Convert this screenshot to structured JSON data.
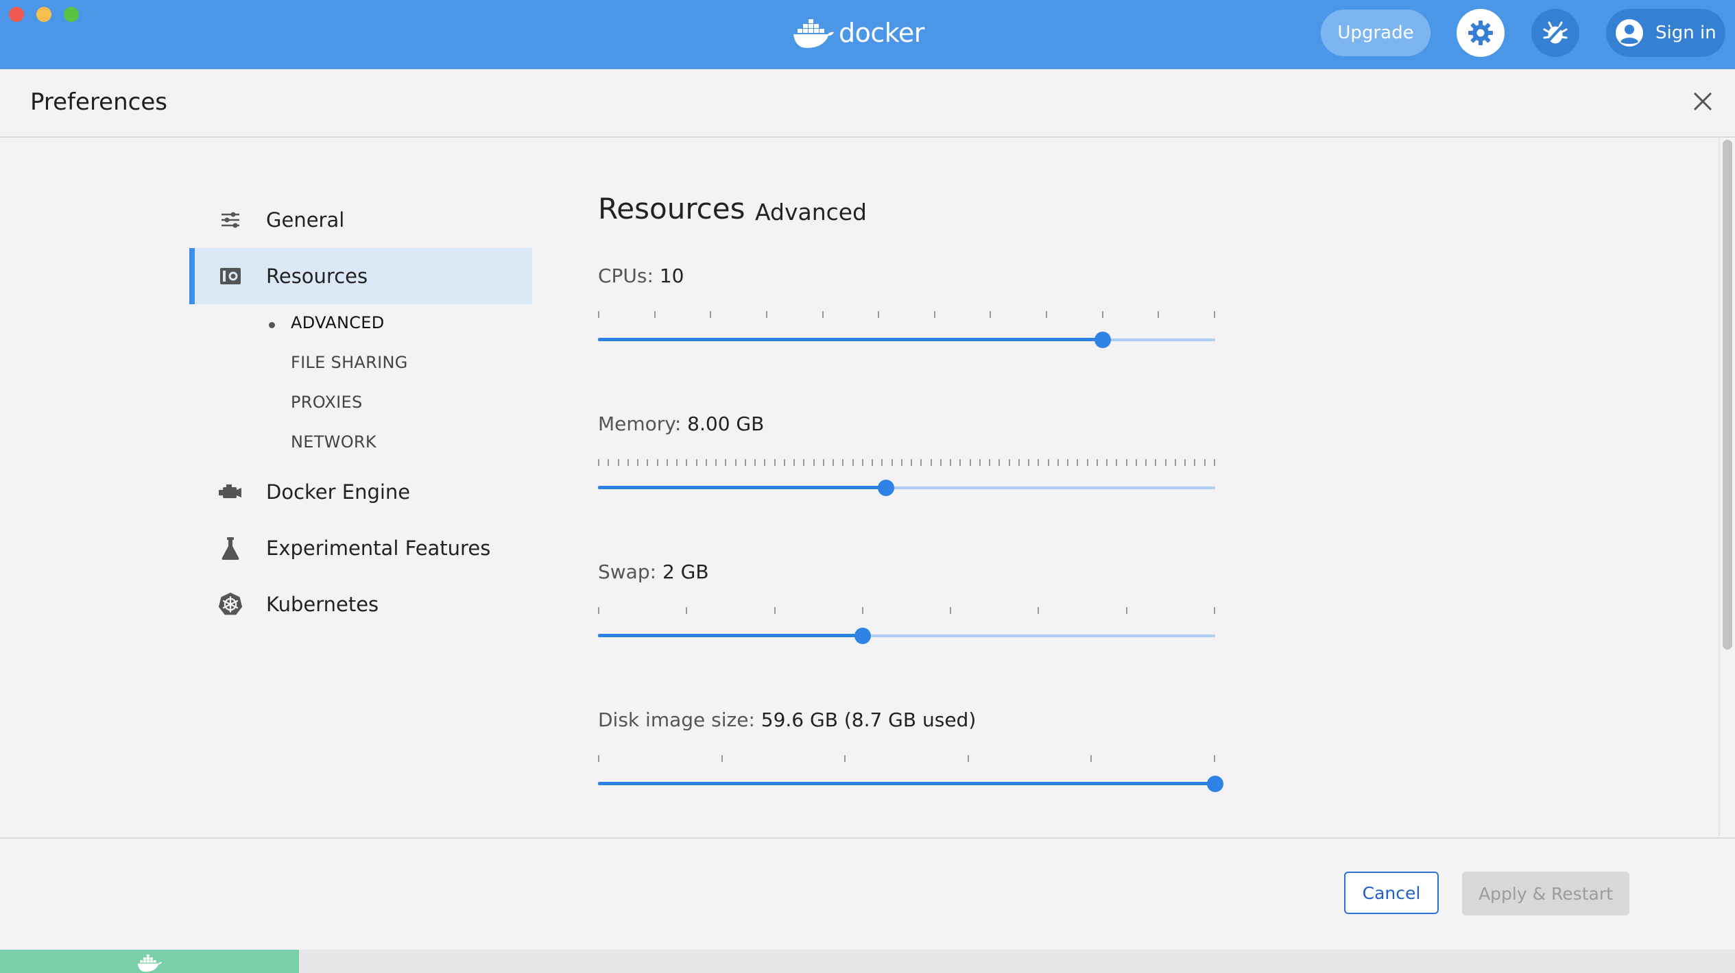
{
  "topbar": {
    "logo_text": "docker",
    "upgrade_label": "Upgrade",
    "signin_label": "Sign in",
    "brand_color": "#4c96e7"
  },
  "header": {
    "title": "Preferences"
  },
  "sidebar": {
    "items": [
      {
        "label": "General",
        "icon": "sliders-icon"
      },
      {
        "label": "Resources",
        "icon": "resources-icon",
        "active": true
      },
      {
        "label": "Docker Engine",
        "icon": "engine-icon"
      },
      {
        "label": "Experimental Features",
        "icon": "flask-icon"
      },
      {
        "label": "Kubernetes",
        "icon": "kubernetes-icon"
      }
    ],
    "subitems": [
      {
        "label": "ADVANCED",
        "active": true
      },
      {
        "label": "FILE SHARING"
      },
      {
        "label": "PROXIES"
      },
      {
        "label": "NETWORK"
      }
    ]
  },
  "content": {
    "section_title": "Resources",
    "subsection_title": "Advanced",
    "settings": [
      {
        "name": "CPUs: ",
        "value": "10",
        "fraction": 0.818,
        "ticks": 12
      },
      {
        "name": "Memory: ",
        "value": "8.00 GB",
        "fraction": 0.467,
        "ticks": 64
      },
      {
        "name": "Swap: ",
        "value": "2 GB",
        "fraction": 0.429,
        "ticks": 8
      },
      {
        "name": "Disk image size: ",
        "value": "59.6 GB (8.7 GB used)",
        "fraction": 1.0,
        "ticks": 6
      }
    ]
  },
  "footer": {
    "cancel_label": "Cancel",
    "apply_label": "Apply & Restart"
  }
}
